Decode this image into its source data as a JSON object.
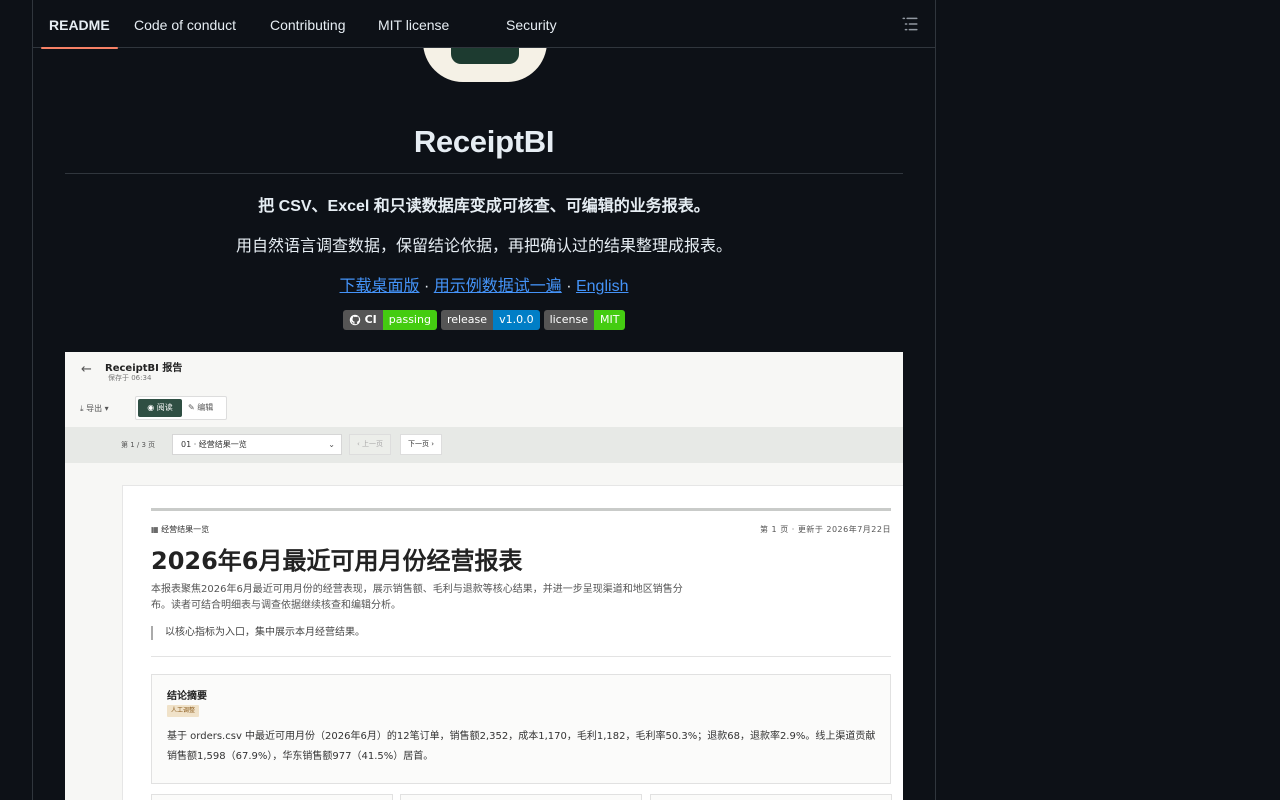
{
  "tabs": [
    {
      "label": "README",
      "active": true
    },
    {
      "label": "Code of conduct",
      "active": false
    },
    {
      "label": "Contributing",
      "active": false
    },
    {
      "label": "MIT license",
      "active": false
    },
    {
      "label": "Security",
      "active": false
    }
  ],
  "toc_icon": "list-outline-icon",
  "readme": {
    "title": "ReceiptBI",
    "tagline": "把 CSV、Excel 和只读数据库变成可核查、可编辑的业务报表。",
    "subline": "用自然语言调查数据，保留结论依据，再把确认过的结果整理成报表。",
    "links": {
      "download": "下载桌面版",
      "sep1": " · ",
      "sample": "用示例数据试一遍",
      "sep2": " · ",
      "english": "English"
    },
    "badges": [
      {
        "left": "CI",
        "right": "passing",
        "color": "#4c1"
      },
      {
        "left": "release",
        "right": "v1.0.0",
        "color": "#007ec6"
      },
      {
        "left": "license",
        "right": "MIT",
        "color": "#4c1"
      }
    ]
  },
  "screenshot": {
    "back_icon": "arrow-left-icon",
    "app_title": "ReceiptBI 报告",
    "saved": "保存于 06:34",
    "export": "导出",
    "read": "阅读",
    "edit": "编辑",
    "page_of": "第 1 / 3 页",
    "select_value": "01 · 经营结果一览",
    "prev": "上一页",
    "next": "下一页",
    "section": "经营结果一览",
    "page_info": "第 1 页 · 更新于 2026年7月22日",
    "heading": "2026年6月最近可用月份经营报表",
    "description": "本报表聚焦2026年6月最近可用月份的经营表现，展示销售额、毛利与退款等核心结果，并进一步呈现渠道和地区销售分布。读者可结合明细表与调查依据继续核查和编辑分析。",
    "quote": "以核心指标为入口，集中展示本月经营结果。",
    "summary_title": "结论摘要",
    "summary_tag": "人工调整",
    "summary_text": "基于 orders.csv 中最近可用月份（2026年6月）的12笔订单，销售额2,352，成本1,170，毛利1,182，毛利率50.3%；退款68，退款率2.9%。线上渠道贡献销售额1,598（67.9%），华东销售额977（41.5%）居首。"
  }
}
